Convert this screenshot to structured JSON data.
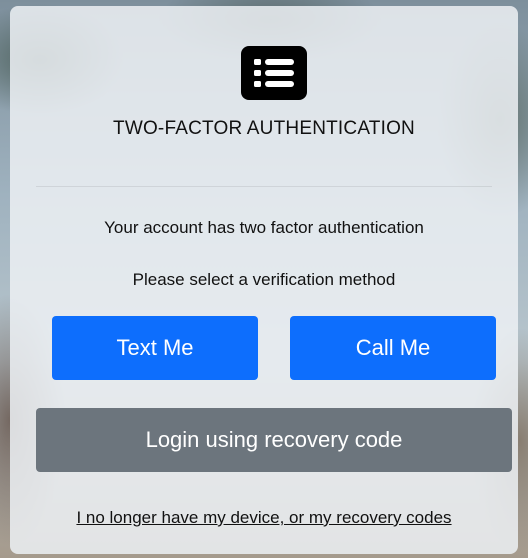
{
  "header": {
    "logo_icon": "list-icon",
    "title": "TWO-FACTOR AUTHENTICATION"
  },
  "messages": {
    "line1": "Your account has two factor authentication",
    "line2": "Please select a verification method"
  },
  "actions": {
    "text_me_label": "Text Me",
    "call_me_label": "Call Me",
    "recovery_label": "Login using recovery code",
    "lost_device_link": "I no longer have my device, or my recovery codes"
  },
  "colors": {
    "primary": "#0d6efd",
    "secondary": "#6c757d",
    "logo_bg": "#000000"
  }
}
